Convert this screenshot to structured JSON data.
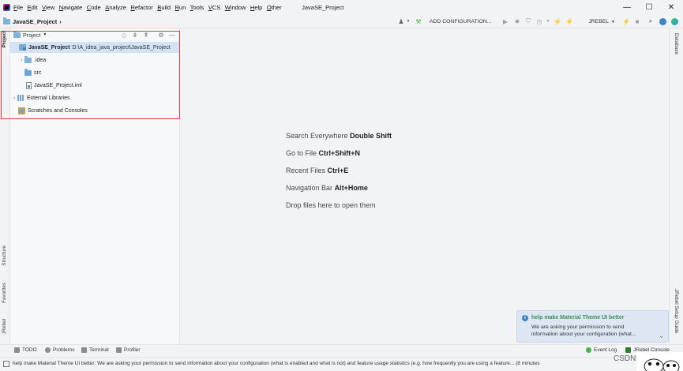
{
  "menubar": {
    "items": [
      "File",
      "Edit",
      "View",
      "Navigate",
      "Code",
      "Analyze",
      "Refactor",
      "Build",
      "Run",
      "Tools",
      "VCS",
      "Window",
      "Help",
      "Other"
    ],
    "title": "JavaSE_Project"
  },
  "navbar": {
    "breadcrumb": "JavaSE_Project",
    "add_configuration": "ADD CONFIGURATION...",
    "jrebel": "JREBEL"
  },
  "left_tabs": {
    "project": "Project",
    "structure": "Structure",
    "favorites": "Favorites",
    "jrebel": "JRebel"
  },
  "right_tabs": {
    "database": "Database",
    "jrebel_setup": "JRebel Setup Guide"
  },
  "project_panel": {
    "title": "Project",
    "tree": [
      {
        "label": "JavaSE_Project",
        "path": "D:\\A_idea_java_project\\JavaSE_Project"
      },
      {
        "label": ".idea"
      },
      {
        "label": "src"
      },
      {
        "label": "JavaSE_Project.iml"
      },
      {
        "label": "External Libraries"
      },
      {
        "label": "Scratches and Consoles"
      }
    ]
  },
  "editor_hints": [
    {
      "text": "Search Everywhere",
      "key": "Double Shift"
    },
    {
      "text": "Go to File",
      "key": "Ctrl+Shift+N"
    },
    {
      "text": "Recent Files",
      "key": "Ctrl+E"
    },
    {
      "text": "Navigation Bar",
      "key": "Alt+Home"
    },
    {
      "text": "Drop files here to open them",
      "key": ""
    }
  ],
  "notification": {
    "title": "help make Material Theme UI better",
    "body": "We are asking your permission to send information about your configuration (what..."
  },
  "toolwindows": {
    "todo": "TODO",
    "problems": "Problems",
    "terminal": "Terminal",
    "profiler": "Profiler",
    "event_log": "Event Log",
    "jrebel_console": "JRebel Console"
  },
  "status": {
    "text": "help make Material Theme UI better: We are asking your permission to send information about your configuration (what is enabled and what is not) and feature usage statistics (e.g. how frequently you are using a feature... (8 minutes"
  },
  "watermark": "CSDN @麦兜",
  "colors": {
    "highlight_border": "#e53935",
    "selection": "#d4e2f5",
    "notif_title": "#3d8f58",
    "background": "#f2f3f5"
  }
}
